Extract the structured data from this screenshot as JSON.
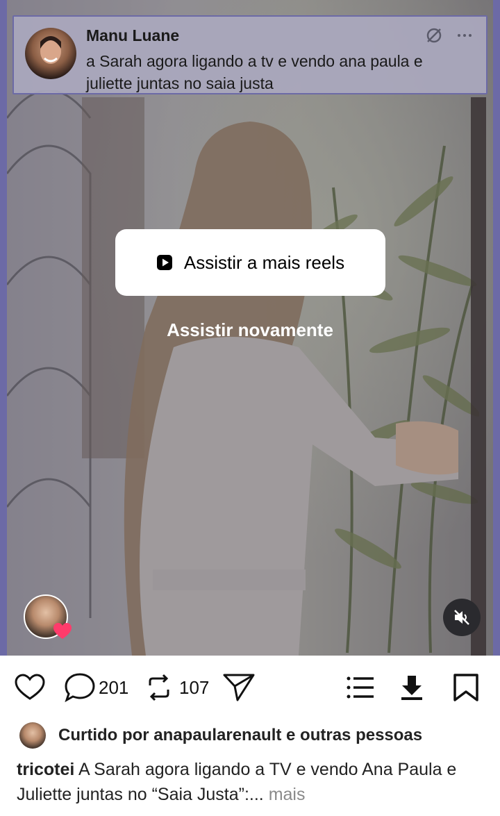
{
  "quote": {
    "author": "Manu Luane",
    "text": "a Sarah agora ligando a tv e vendo ana paula e juliette juntas no saia justa"
  },
  "overlay": {
    "more_reels_label": "Assistir a mais reels",
    "replay_label": "Assistir novamente"
  },
  "actions": {
    "comments_count": "201",
    "reposts_count": "107"
  },
  "liked_by": "Curtido por anapaularenault e outras pessoas",
  "caption": {
    "username": "tricotei",
    "text": "A Sarah agora ligando a TV e vendo Ana Paula e Juliette juntas no “Saia Justa”:...",
    "more_label": "mais"
  },
  "colors": {
    "accent_border": "#6c6aa6",
    "heart_badge": "#ff3b6b"
  },
  "icons": [
    "muted-icon",
    "more-icon",
    "play-icon",
    "heart-icon",
    "comment-icon",
    "repost-icon",
    "share-icon",
    "list-icon",
    "download-icon",
    "bookmark-icon",
    "volume-off-icon"
  ]
}
